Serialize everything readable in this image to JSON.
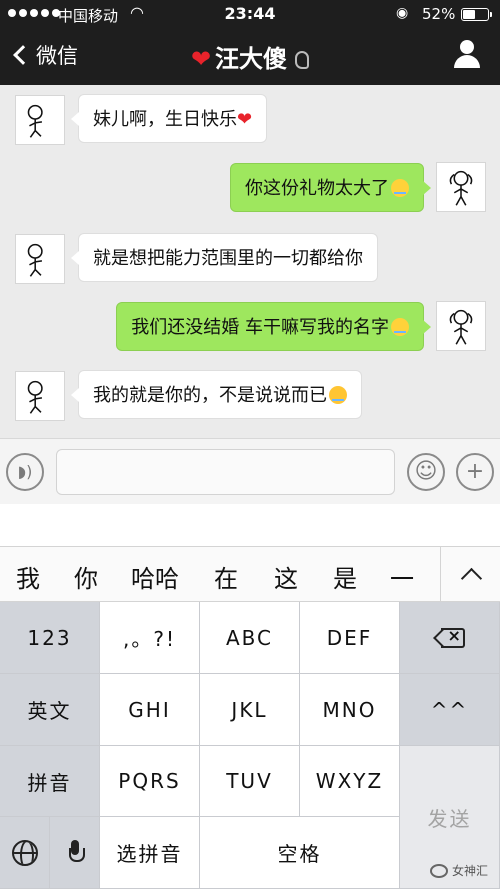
{
  "status_bar": {
    "carrier": "中国移动",
    "time": "23:44",
    "battery_percent_text": "52%",
    "battery_level": 0.52
  },
  "nav": {
    "back_label": "微信",
    "title": "汪大傻",
    "title_prefix_icon": "red-heart"
  },
  "messages": [
    {
      "side": "in",
      "text": "妹儿啊，生日快乐",
      "emoji": "red-heart"
    },
    {
      "side": "out",
      "text": "你这份礼物太大了",
      "emoji": "crying-face"
    },
    {
      "side": "in",
      "text": "就是想把能力范围里的一切都给你"
    },
    {
      "side": "out",
      "text": "我们还没结婚 车干嘛写我的名字",
      "emoji": "crying-face"
    },
    {
      "side": "in",
      "text": "我的就是你的，不是说说而已",
      "emoji": "laughing-face"
    }
  ],
  "candidates": [
    "我",
    "你",
    "哈哈",
    "在",
    "这",
    "是",
    "一"
  ],
  "keyboard": {
    "left": [
      "123",
      "英文",
      "拼音"
    ],
    "rows": [
      [
        ",。?!",
        "ABC",
        "DEF"
      ],
      [
        "GHI",
        "JKL",
        "MNO"
      ],
      [
        "PQRS",
        "TUV",
        "WXYZ"
      ]
    ],
    "right_mid": "^^",
    "select_pinyin": "选拼音",
    "space": "空格",
    "send": "发送"
  },
  "watermark": "女神汇",
  "colors": {
    "header_bg": "#1e1e1e",
    "bubble_out": "#9ee75e",
    "heart": "#e8232b"
  }
}
